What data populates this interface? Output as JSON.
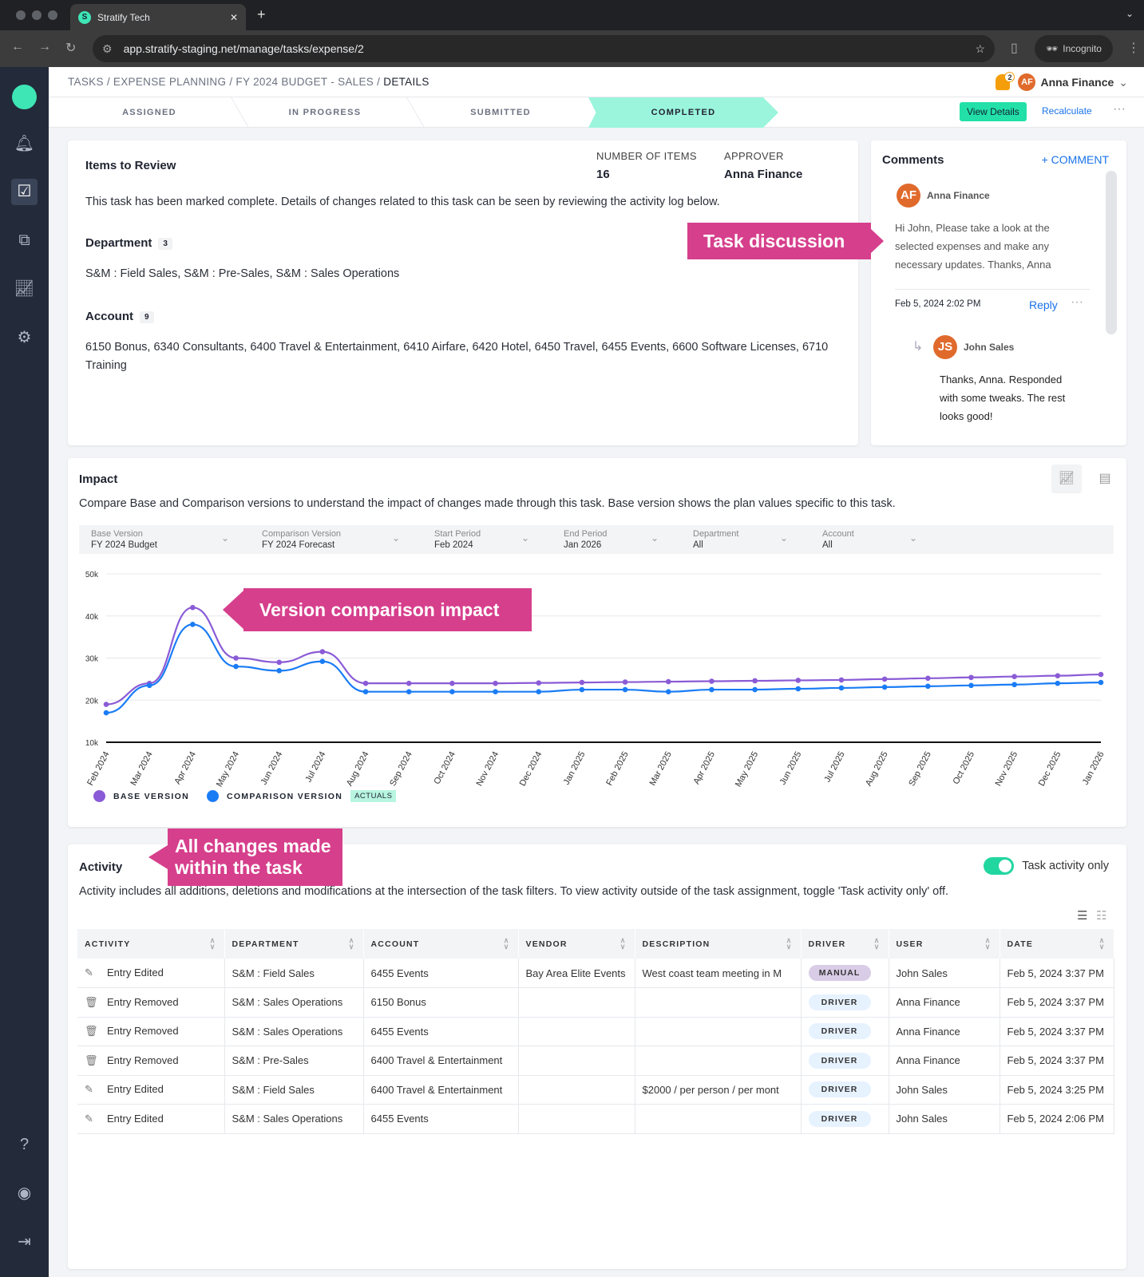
{
  "browser": {
    "tab_title": "Stratify Tech",
    "url": "app.stratify-staging.net/manage/tasks/expense/2",
    "incognito": "Incognito"
  },
  "header": {
    "breadcrumb": [
      "TASKS",
      "EXPENSE PLANNING",
      "FY 2024 BUDGET - SALES"
    ],
    "breadcrumb_current": "DETAILS",
    "notification_count": "2",
    "user_initials": "AF",
    "user_name": "Anna Finance"
  },
  "steps": [
    {
      "label": "ASSIGNED"
    },
    {
      "label": "IN PROGRESS"
    },
    {
      "label": "SUBMITTED"
    },
    {
      "label": "COMPLETED",
      "active": true
    }
  ],
  "actions": {
    "view_details": "View Details",
    "recalculate": "Recalculate"
  },
  "review": {
    "title": "Items to Review",
    "num_items_label": "NUMBER OF ITEMS",
    "num_items": "16",
    "approver_label": "APPROVER",
    "approver": "Anna Finance",
    "message": "This task has been marked complete. Details of changes related to this task can be seen by reviewing the activity log below.",
    "department_label": "Department",
    "department_count": "3",
    "departments": "S&M : Field Sales, S&M : Pre-Sales, S&M : Sales Operations",
    "account_label": "Account",
    "account_count": "9",
    "accounts": "6150 Bonus, 6340 Consultants, 6400 Travel & Entertainment, 6410 Airfare, 6420 Hotel, 6450 Travel, 6455 Events, 6600 Software Licenses, 6710 Training"
  },
  "comments": {
    "title": "Comments",
    "add": "+ COMMENT",
    "first": {
      "initials": "AF",
      "author": "Anna Finance",
      "text": "Hi John, Please take a look at the selected expenses and make any necessary updates. Thanks, Anna",
      "time": "Feb 5, 2024 2:02 PM",
      "reply": "Reply"
    },
    "reply": {
      "initials": "JS",
      "author": "John Sales",
      "text": "Thanks, Anna. Responded with some tweaks. The rest looks good!"
    }
  },
  "annotations": {
    "task_discussion": "Task discussion",
    "version_impact": "Version comparison impact",
    "all_changes": "All changes made within the task"
  },
  "impact": {
    "title": "Impact",
    "description": "Compare Base and Comparison versions to understand the impact of changes made through this task. Base version shows the plan values specific to this task.",
    "filters": [
      {
        "label": "Base Version",
        "value": "FY 2024 Budget"
      },
      {
        "label": "Comparison Version",
        "value": "FY 2024 Forecast"
      },
      {
        "label": "Start Period",
        "value": "Feb 2024"
      },
      {
        "label": "End Period",
        "value": "Jan 2026"
      },
      {
        "label": "Department",
        "value": "All"
      },
      {
        "label": "Account",
        "value": "All"
      }
    ]
  },
  "chart_data": {
    "type": "line",
    "ylim": [
      10000,
      50000
    ],
    "yticks": [
      "10k",
      "20k",
      "30k",
      "40k",
      "50k"
    ],
    "grid": true,
    "legend_placement": "bottom-left",
    "categories": [
      "Feb 2024",
      "Mar 2024",
      "Apr 2024",
      "May 2024",
      "Jun 2024",
      "Jul 2024",
      "Aug 2024",
      "Sep 2024",
      "Oct 2024",
      "Nov 2024",
      "Dec 2024",
      "Jan 2025",
      "Feb 2025",
      "Mar 2025",
      "Apr 2025",
      "May 2025",
      "Jun 2025",
      "Jul 2025",
      "Aug 2025",
      "Sep 2025",
      "Oct 2025",
      "Nov 2025",
      "Dec 2025",
      "Jan 2026"
    ],
    "series": [
      {
        "name": "BASE VERSION",
        "color": "#8a5bd6",
        "values": [
          19000,
          24000,
          42000,
          30000,
          29000,
          31500,
          24000,
          24000,
          24000,
          24000,
          24100,
          24200,
          24300,
          24400,
          24500,
          24600,
          24700,
          24800,
          25000,
          25200,
          25400,
          25600,
          25800,
          26100
        ]
      },
      {
        "name": "COMPARISON VERSION",
        "color": "#1a7cf5",
        "values": [
          17000,
          23500,
          38000,
          28000,
          27000,
          29200,
          22000,
          22000,
          22000,
          22000,
          22000,
          22500,
          22500,
          22000,
          22500,
          22500,
          22700,
          22900,
          23100,
          23300,
          23500,
          23700,
          24000,
          24200
        ]
      }
    ],
    "legend_tag": "ACTUALS"
  },
  "activity": {
    "title": "Activity",
    "toggle_label": "Task activity only",
    "toggle_on": true,
    "description": "Activity includes all additions, deletions and modifications at the intersection of the task filters. To view activity outside of the task assignment, toggle 'Task activity only' off.",
    "columns": [
      "ACTIVITY",
      "DEPARTMENT",
      "ACCOUNT",
      "VENDOR",
      "DESCRIPTION",
      "DRIVER",
      "USER",
      "DATE"
    ],
    "rows": [
      {
        "icon": "pencil-icon",
        "activity": "Entry Edited",
        "department": "S&M : Field Sales",
        "account": "6455 Events",
        "vendor": "Bay Area Elite Events",
        "description": "West coast team meeting in M",
        "driver": "MANUAL",
        "user": "John Sales",
        "date": "Feb 5, 2024 3:37 PM"
      },
      {
        "icon": "trash-icon",
        "activity": "Entry Removed",
        "department": "S&M : Sales Operations",
        "account": "6150 Bonus",
        "vendor": "",
        "description": "",
        "driver": "DRIVER",
        "user": "Anna Finance",
        "date": "Feb 5, 2024 3:37 PM"
      },
      {
        "icon": "trash-icon",
        "activity": "Entry Removed",
        "department": "S&M : Sales Operations",
        "account": "6455 Events",
        "vendor": "",
        "description": "",
        "driver": "DRIVER",
        "user": "Anna Finance",
        "date": "Feb 5, 2024 3:37 PM"
      },
      {
        "icon": "trash-icon",
        "activity": "Entry Removed",
        "department": "S&M : Pre-Sales",
        "account": "6400 Travel & Entertainment",
        "vendor": "",
        "description": "",
        "driver": "DRIVER",
        "user": "Anna Finance",
        "date": "Feb 5, 2024 3:37 PM"
      },
      {
        "icon": "pencil-icon",
        "activity": "Entry Edited",
        "department": "S&M : Field Sales",
        "account": "6400 Travel & Entertainment",
        "vendor": "",
        "description": "$2000 / per person / per mont",
        "driver": "DRIVER",
        "user": "John Sales",
        "date": "Feb 5, 2024 3:25 PM"
      },
      {
        "icon": "pencil-icon",
        "activity": "Entry Edited",
        "department": "S&M : Sales Operations",
        "account": "6455 Events",
        "vendor": "",
        "description": "",
        "driver": "DRIVER",
        "user": "John Sales",
        "date": "Feb 5, 2024 2:06 PM"
      }
    ]
  }
}
